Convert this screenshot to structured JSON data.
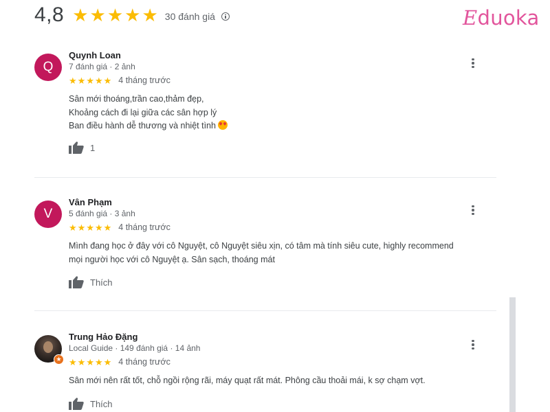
{
  "summary": {
    "rating": "4,8",
    "stars": 5,
    "review_count": "30 đánh giá",
    "info_icon": "info-icon"
  },
  "logo": {
    "mark": "E",
    "text": "duoka",
    "color": "#e2559c"
  },
  "reviews": [
    {
      "avatar_letter": "Q",
      "avatar_color": "#c2185b",
      "name": "Quynh Loan",
      "meta": "7 đánh giá · 2 ảnh",
      "stars": 5,
      "date": "4 tháng trước",
      "text_lines": [
        "Sân mới thoáng,trần cao,thảm đẹp,",
        "Khoảng cách đi lại giữa các sân hợp lý",
        "Ban điều hành dễ thương và nhiệt tình"
      ],
      "emoji": "smiling-face-with-heart-eyes",
      "like_label": "1"
    },
    {
      "avatar_letter": "V",
      "avatar_color": "#c2185b",
      "name": "Vân Phạm",
      "meta": "5 đánh giá · 3 ảnh",
      "stars": 5,
      "date": "4 tháng trước",
      "text_lines": [
        "Mình đang học ở đây với cô Nguyệt, cô Nguyệt siêu xịn, có tâm mà tính siêu cute, highly recommend",
        "mọi người học với cô Nguyệt ạ. Sân sạch, thoáng mát"
      ],
      "like_label": "Thích"
    },
    {
      "avatar_letter": "",
      "name": "Trung Hảo Đặng",
      "meta": "Local Guide · 149 đánh giá · 14 ảnh",
      "stars": 5,
      "date": "4 tháng trước",
      "text_lines": [
        "Sân mới nên rất tốt, chỗ ngồi rộng rãi, máy quạt rất mát. Phông cầu thoải mái, k sợ chạm vợt."
      ],
      "like_label": "Thích"
    }
  ],
  "colors": {
    "star": "#fbbc04",
    "avatar": "#c2185b",
    "guide_badge": "#e8711c"
  }
}
